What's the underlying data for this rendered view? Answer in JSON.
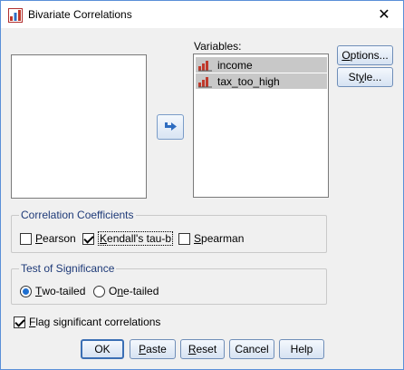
{
  "window": {
    "title": "Bivariate Correlations",
    "close_glyph": "✕"
  },
  "variables": {
    "label": "Variables:",
    "items": [
      {
        "name": "income",
        "icon": "scale-variable-icon"
      },
      {
        "name": "tax_too_high",
        "icon": "scale-variable-icon"
      }
    ]
  },
  "side_buttons": {
    "options": {
      "pre": "",
      "u": "O",
      "post": "ptions..."
    },
    "style": {
      "pre": "St",
      "u": "y",
      "post": "le..."
    }
  },
  "coefficients": {
    "title": "Correlation Coefficients",
    "pearson": {
      "pre": "",
      "u": "P",
      "post": "earson",
      "checked": false
    },
    "kendall": {
      "pre": "",
      "u": "K",
      "post": "endall's tau-b",
      "checked": true
    },
    "spearman": {
      "pre": "",
      "u": "S",
      "post": "pearman",
      "checked": false
    }
  },
  "significance": {
    "title": "Test of Significance",
    "two_tailed": {
      "pre": "",
      "u": "T",
      "post": "wo-tailed",
      "selected": true
    },
    "one_tailed": {
      "pre": "O",
      "u": "n",
      "post": "e-tailed",
      "selected": false
    }
  },
  "flag": {
    "pre": "",
    "u": "F",
    "post": "lag significant correlations",
    "checked": true
  },
  "bottom_buttons": {
    "ok": {
      "pre": "OK",
      "u": "",
      "post": ""
    },
    "paste": {
      "pre": "",
      "u": "P",
      "post": "aste"
    },
    "reset": {
      "pre": "",
      "u": "R",
      "post": "eset"
    },
    "cancel": {
      "pre": "Cancel",
      "u": "",
      "post": ""
    },
    "help": {
      "pre": "Help",
      "u": "",
      "post": ""
    }
  },
  "colors": {
    "accent": "#1f6fd0",
    "group_title": "#1e3a78",
    "selection": "#c8c8c8"
  }
}
